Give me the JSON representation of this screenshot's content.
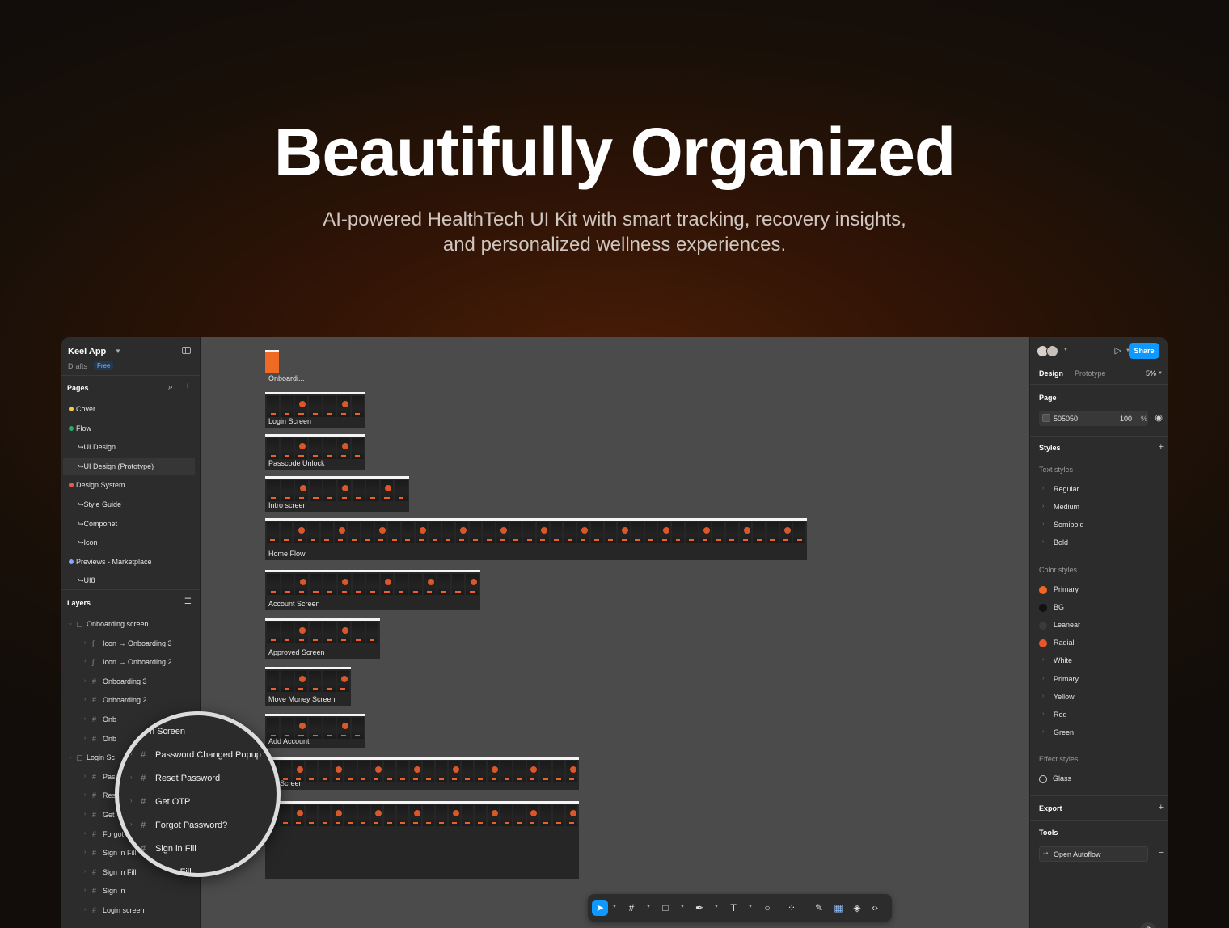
{
  "hero": {
    "title": "Beautifully Organized",
    "subtitle_line1": "AI-powered HealthTech UI Kit with smart tracking, recovery insights,",
    "subtitle_line2": "and personalized wellness experiences."
  },
  "file": {
    "name": "Keel App",
    "drafts": "Drafts",
    "plan": "Free"
  },
  "pages": {
    "label": "Pages",
    "items": [
      {
        "label": "Cover",
        "color": "#f2c94c"
      },
      {
        "label": "Flow",
        "color": "#27ae60"
      },
      {
        "label": "↪UI Design"
      },
      {
        "label": "↪UI Design (Prototype)"
      },
      {
        "label": "Design System",
        "color": "#eb5757"
      },
      {
        "label": "↪Style Guide"
      },
      {
        "label": "↪Componet"
      },
      {
        "label": "↪Icon"
      },
      {
        "label": "Previews - Marketplace",
        "color": "#8aa4ff"
      },
      {
        "label": "↪UI8"
      }
    ]
  },
  "layers": {
    "label": "Layers",
    "items": [
      "Onboarding screen",
      "Icon → Onboarding 3",
      "Icon → Onboarding 2",
      "Onboarding 3",
      "Onboarding 2",
      "Onb",
      "Onb",
      "Login Sc",
      "Pas",
      "Res",
      "Get",
      "Forgot",
      "Sign in Fill",
      "Sign in Fill",
      "Sign in",
      "Login screen"
    ]
  },
  "magnifier": {
    "items": [
      "n Screen",
      "Password Changed Popup",
      "Reset Password",
      "Get OTP",
      "Forgot Password?",
      "Sign in Fill",
      "in Fill"
    ]
  },
  "canvas": {
    "frames": [
      "Onboardi...",
      "Login Screen",
      "Passcode Unlock",
      "Intro screen",
      "Home Flow",
      "Account Screen",
      "Approved Screen",
      "Move Money Screen",
      "Add Account",
      "file Screen"
    ]
  },
  "toolbar": {
    "tools": [
      "move-tool",
      "frame-tool",
      "shape-tool",
      "pen-tool",
      "text-tool",
      "comment-tool",
      "actions-tool",
      "draw-tool",
      "dev-mode-toggle",
      "component-tool",
      "code-tool"
    ]
  },
  "right": {
    "share": "Share",
    "tabs": {
      "design": "Design",
      "prototype": "Prototype"
    },
    "zoom": "5%",
    "page_label": "Page",
    "page_color": "505050",
    "page_opacity": "100",
    "page_opacity_unit": "%",
    "styles_label": "Styles",
    "text_styles_label": "Text styles",
    "text_styles": [
      "Regular",
      "Medium",
      "Semibold",
      "Bold"
    ],
    "color_styles_label": "Color styles",
    "color_styles": [
      {
        "label": "Primary",
        "color": "#f26522"
      },
      {
        "label": "BG",
        "color": "#111111"
      },
      {
        "label": "Leanear",
        "color": "#3a3a3a"
      },
      {
        "label": "Radial",
        "color": "#e8572a"
      },
      {
        "label": "White"
      },
      {
        "label": "Primary"
      },
      {
        "label": "Yellow"
      },
      {
        "label": "Red"
      },
      {
        "label": "Green"
      }
    ],
    "effect_styles_label": "Effect styles",
    "effect_styles": [
      "Glass"
    ],
    "export_label": "Export",
    "tools_label": "Tools",
    "plugin": "Open Autoflow",
    "help": "?"
  }
}
